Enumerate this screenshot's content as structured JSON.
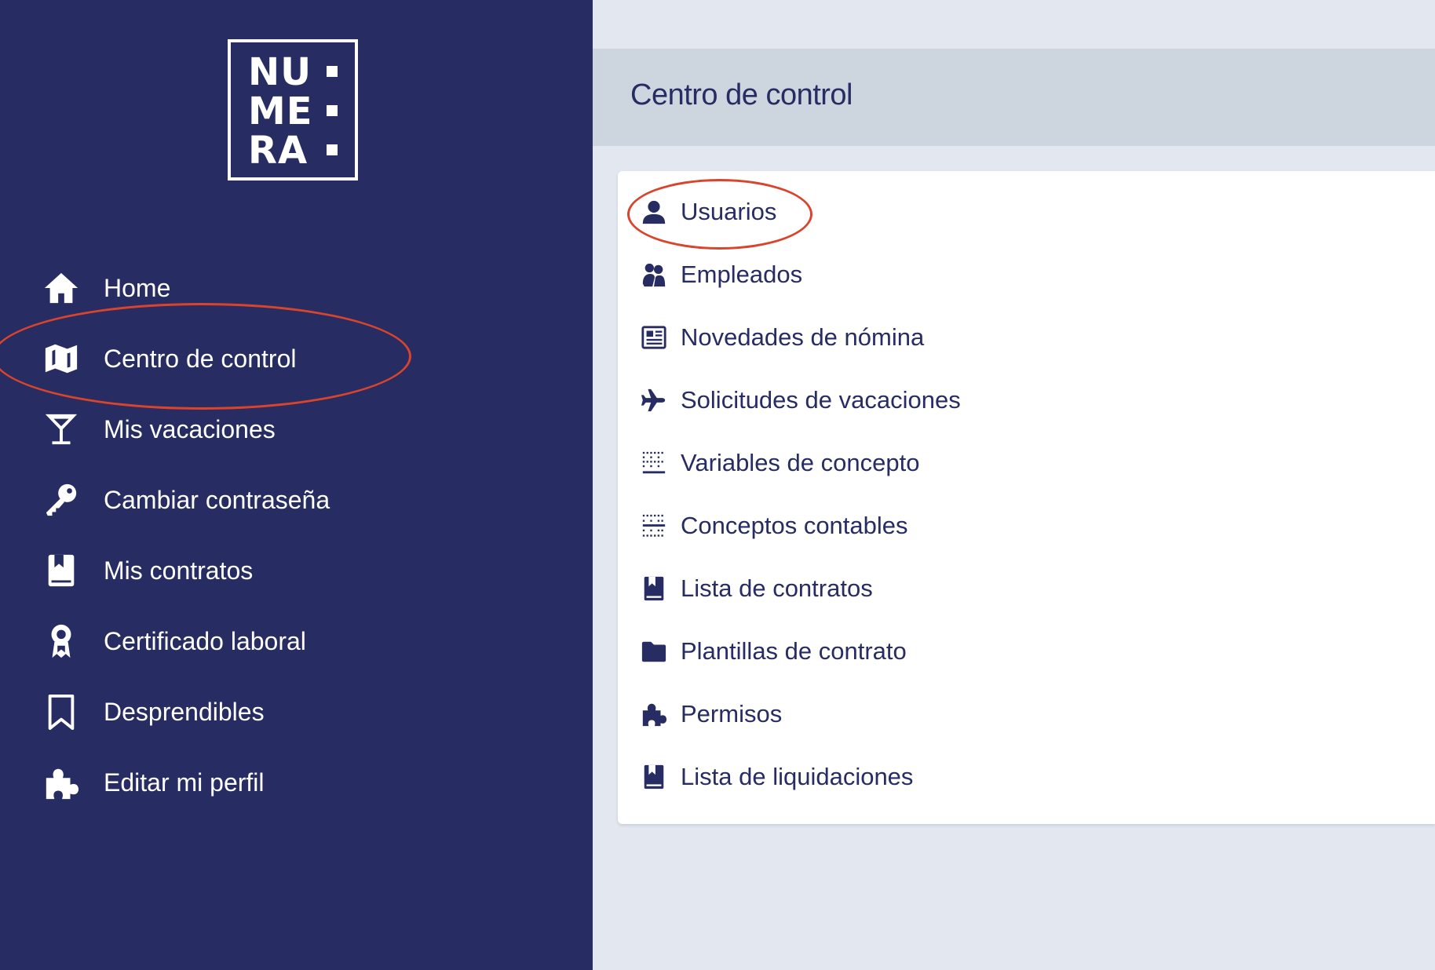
{
  "brand": {
    "logo_lines": [
      "NU",
      "ME",
      "RA"
    ]
  },
  "colors": {
    "sidebar_bg": "#272c62",
    "main_bg": "#e3e8f0",
    "header_bg": "#cdd5df",
    "accent_text": "#272c62",
    "annotation": "#d9442c"
  },
  "sidebar": {
    "items": [
      {
        "label": "Home",
        "icon": "home-icon"
      },
      {
        "label": "Centro de control",
        "icon": "map-icon"
      },
      {
        "label": "Mis vacaciones",
        "icon": "cocktail-icon"
      },
      {
        "label": "Cambiar contraseña",
        "icon": "key-icon"
      },
      {
        "label": "Mis contratos",
        "icon": "book-icon"
      },
      {
        "label": "Certificado laboral",
        "icon": "award-icon"
      },
      {
        "label": "Desprendibles",
        "icon": "bookmark-icon"
      },
      {
        "label": "Editar mi perfil",
        "icon": "puzzle-icon"
      }
    ]
  },
  "main": {
    "title": "Centro de control",
    "menu": [
      {
        "label": "Usuarios",
        "icon": "user-icon"
      },
      {
        "label": "Empleados",
        "icon": "users-icon"
      },
      {
        "label": "Novedades de nómina",
        "icon": "newspaper-icon"
      },
      {
        "label": "Solicitudes de vacaciones",
        "icon": "plane-icon"
      },
      {
        "label": "Variables de concepto",
        "icon": "border-grid-icon"
      },
      {
        "label": "Conceptos contables",
        "icon": "grid-dots-icon"
      },
      {
        "label": "Lista de contratos",
        "icon": "book-icon"
      },
      {
        "label": "Plantillas de contrato",
        "icon": "folder-icon"
      },
      {
        "label": "Permisos",
        "icon": "puzzle-icon"
      },
      {
        "label": "Lista de liquidaciones",
        "icon": "book-icon"
      }
    ]
  }
}
